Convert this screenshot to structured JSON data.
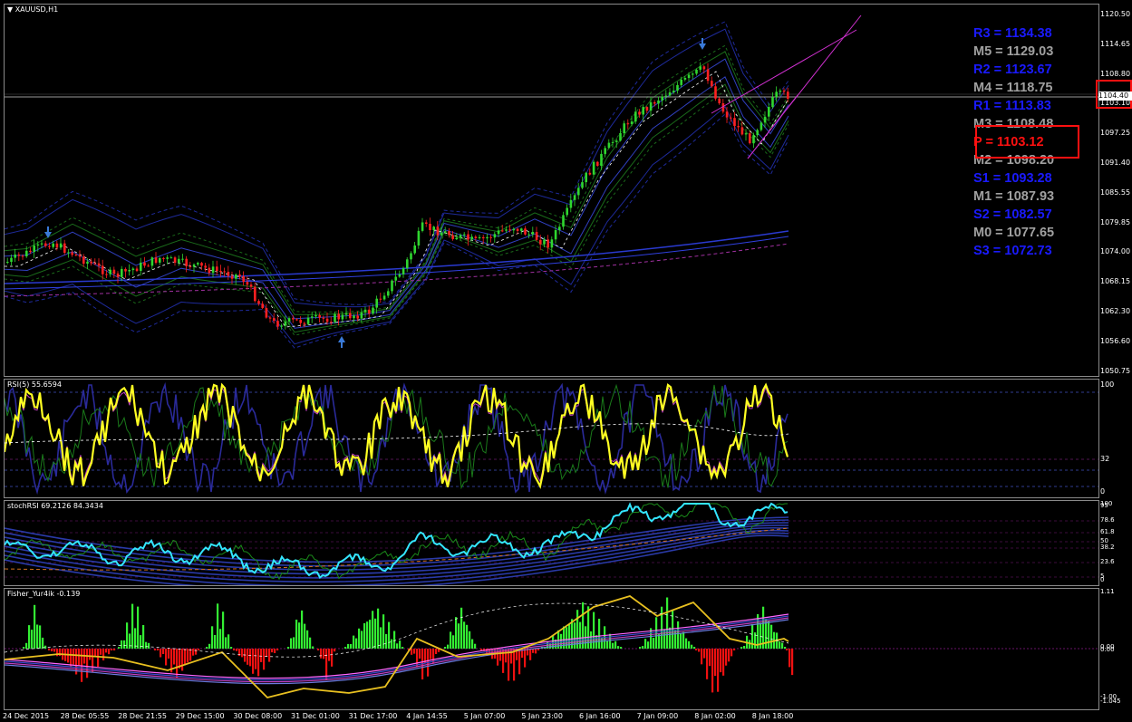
{
  "main": {
    "title": "XAUUSD,H1",
    "price_ticks": [
      "1120.50",
      "1114.65",
      "1108.80",
      "1103.10",
      "1097.25",
      "1091.40",
      "1085.55",
      "1079.85",
      "1074.00",
      "1068.15",
      "1062.30",
      "1056.60",
      "1050.75"
    ],
    "current_price": "1104.40",
    "pivots": [
      {
        "label": "R3 = 1134.38",
        "color": "#1a1aff"
      },
      {
        "label": "M5 = 1129.03",
        "color": "#a0a0a0"
      },
      {
        "label": "R2 = 1123.67",
        "color": "#1a1aff"
      },
      {
        "label": "M4 = 1118.75",
        "color": "#a0a0a0"
      },
      {
        "label": "R1 = 1113.83",
        "color": "#1a1aff"
      },
      {
        "label": "M3 = 1108.48",
        "color": "#a0a0a0"
      },
      {
        "label": "P  = 1103.12",
        "color": "#ff1010"
      },
      {
        "label": "M2 = 1098.20",
        "color": "#a0a0a0"
      },
      {
        "label": "S1 = 1093.28",
        "color": "#1a1aff"
      },
      {
        "label": "M1 = 1087.93",
        "color": "#a0a0a0"
      },
      {
        "label": "S2 = 1082.57",
        "color": "#1a1aff"
      },
      {
        "label": "M0 = 1077.65",
        "color": "#a0a0a0"
      },
      {
        "label": "S3 = 1072.73",
        "color": "#1a1aff"
      }
    ]
  },
  "rsi": {
    "title": "RSI(5) 55.6594",
    "ticks": [
      "100",
      "32",
      "0"
    ]
  },
  "stoch": {
    "title": "stochRSI 69.2126 84.3434",
    "ticks": [
      "100",
      "95",
      "78.6",
      "61.8",
      "50",
      "38.2",
      "23.6",
      "5",
      "0"
    ]
  },
  "fisher": {
    "title": "Fisher_Yur4ik -0.139",
    "ticks": [
      "1.11",
      "0.00",
      "0.00",
      "-1.00",
      "-1.045"
    ]
  },
  "time_labels": [
    "24 Dec 2015",
    "28 Dec 05:55",
    "28 Dec 21:55",
    "29 Dec 15:00",
    "30 Dec 08:00",
    "31 Dec 01:00",
    "31 Dec 17:00",
    "4 Jan 14:55",
    "5 Jan 07:00",
    "5 Jan 23:00",
    "6 Jan 16:00",
    "7 Jan 09:00",
    "8 Jan 02:00",
    "8 Jan 18:00"
  ],
  "colors": {
    "bull": "#2fd62f",
    "bear": "#ff2020",
    "fisher_pos": "#33ee33",
    "fisher_neg": "#ee1111",
    "rsi_line": "#ffff22",
    "cyan": "#33e6ff",
    "magenta": "#ff44ff",
    "blue": "#2838b8"
  }
}
